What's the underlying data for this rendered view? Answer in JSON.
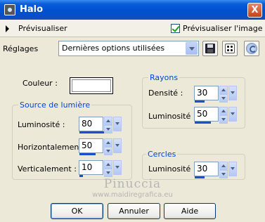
{
  "window": {
    "title": "Halo",
    "close_glyph": "X"
  },
  "preview": {
    "expand_label": "Prévisualiser",
    "checkbox_label": "Prévisualiser l'image",
    "checked": true
  },
  "settings": {
    "label": "Réglages",
    "preset_value": "Dernières options utilisées"
  },
  "color": {
    "label": "Couleur :",
    "value": "#ffffff"
  },
  "light_source": {
    "title": "Source de lumière",
    "fields": [
      {
        "label": "Luminosité :",
        "value": "80",
        "level": 0.8
      },
      {
        "label": "Horizontalement :",
        "value": "50",
        "level": 0.5
      },
      {
        "label": "Verticalement :",
        "value": "10",
        "level": 0.1
      }
    ]
  },
  "rays": {
    "title": "Rayons",
    "fields": [
      {
        "label": "Densité :",
        "value": "30",
        "level": 0.3
      },
      {
        "label": "Luminosité :",
        "value": "50",
        "level": 0.5
      }
    ]
  },
  "circles": {
    "title": "Cercles",
    "fields": [
      {
        "label": "Luminosité :",
        "value": "30",
        "level": 0.3
      }
    ]
  },
  "watermark": {
    "line1": "Pinuccia",
    "line2": "www.maidiregrafica.eu"
  },
  "buttons": {
    "ok": "OK",
    "cancel": "Annuler",
    "help": "Aide"
  },
  "colors": {
    "accent": "#0046d5",
    "titlebar": "#0050d0",
    "face": "#ece9d8",
    "spin_level": "#1a4fd0"
  }
}
